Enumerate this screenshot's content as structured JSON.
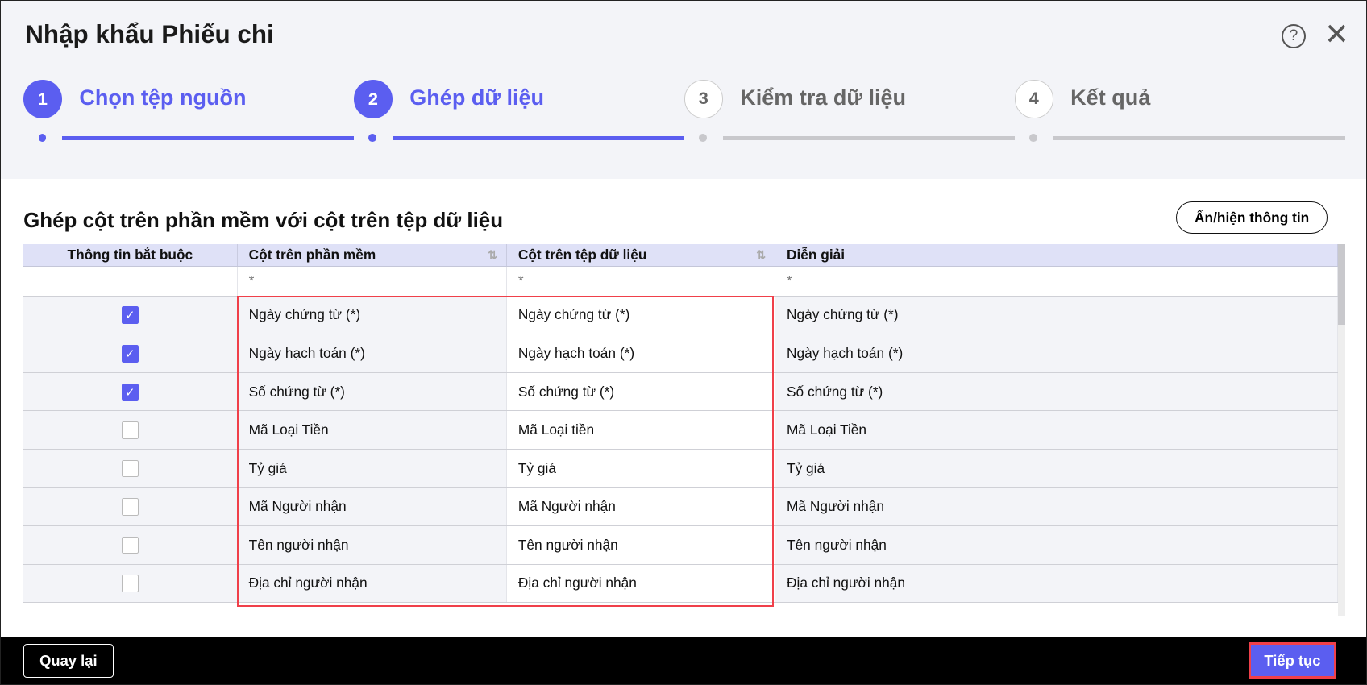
{
  "dialog": {
    "title": "Nhập khẩu Phiếu chi"
  },
  "steps": [
    {
      "number": "1",
      "label": "Chọn tệp nguồn",
      "state": "done"
    },
    {
      "number": "2",
      "label": "Ghép dữ liệu",
      "state": "active"
    },
    {
      "number": "3",
      "label": "Kiểm tra dữ liệu",
      "state": "pending"
    },
    {
      "number": "4",
      "label": "Kết quả",
      "state": "pending"
    }
  ],
  "section": {
    "title": "Ghép cột trên phần mềm với cột trên tệp dữ liệu",
    "toggle_label": "Ẩn/hiện thông tin"
  },
  "table": {
    "headers": [
      "Thông tin bắt buộc",
      "Cột trên phần mềm",
      "Cột trên tệp dữ liệu",
      "Diễn giải"
    ],
    "filter": "*",
    "rows": [
      {
        "required": true,
        "software": "Ngày chứng từ (*)",
        "file": "Ngày chứng từ (*)",
        "desc": "Ngày chứng từ (*)"
      },
      {
        "required": true,
        "software": "Ngày hạch toán (*)",
        "file": "Ngày hạch toán (*)",
        "desc": "Ngày hạch toán (*)"
      },
      {
        "required": true,
        "software": "Số chứng từ (*)",
        "file": "Số chứng từ (*)",
        "desc": "Số chứng từ (*)"
      },
      {
        "required": false,
        "software": "Mã Loại Tiền",
        "file": "Mã Loại tiền",
        "desc": "Mã Loại Tiền"
      },
      {
        "required": false,
        "software": "Tỷ giá",
        "file": "Tỷ giá",
        "desc": "Tỷ giá"
      },
      {
        "required": false,
        "software": "Mã Người nhận",
        "file": "Mã Người nhận",
        "desc": "Mã Người nhận"
      },
      {
        "required": false,
        "software": "Tên người nhận",
        "file": "Tên người nhận",
        "desc": "Tên người nhận"
      },
      {
        "required": false,
        "software": "Địa chỉ người nhận",
        "file": "Địa chỉ người nhận",
        "desc": "Địa chỉ người nhận"
      }
    ]
  },
  "footer": {
    "back_label": "Quay lại",
    "next_label": "Tiếp tục"
  },
  "colors": {
    "accent": "#5b5ef0",
    "highlight": "#f0404a"
  }
}
